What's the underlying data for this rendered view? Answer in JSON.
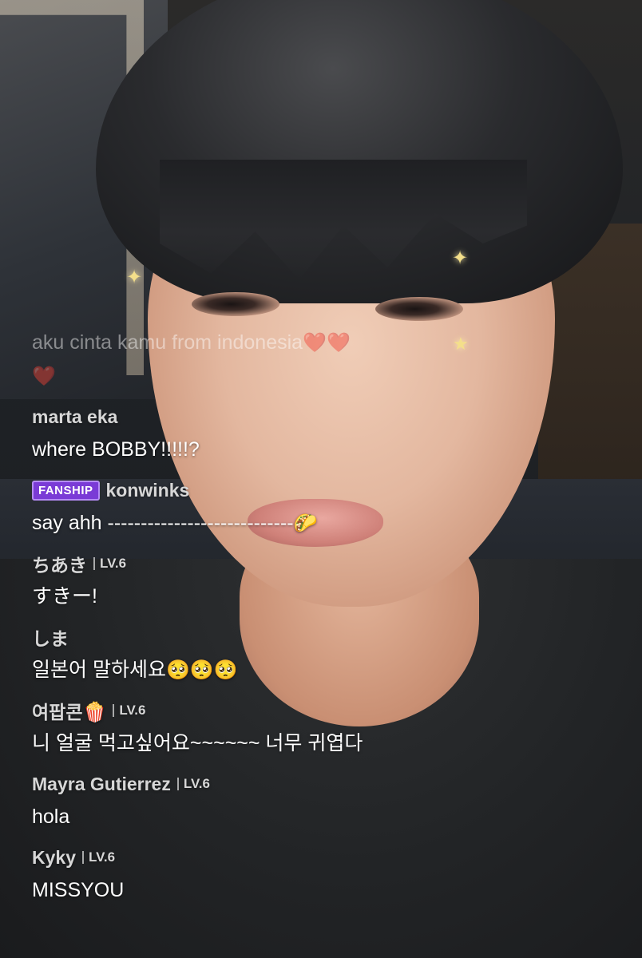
{
  "live_chat": {
    "messages": [
      {
        "text": "aku cinta kamu from indonesia",
        "emoji": "❤️❤️",
        "text_line2_emoji": "❤️",
        "faded": true
      },
      {
        "username": "marta eka",
        "text": "where BOBBY!!!!!?"
      },
      {
        "badge": "FANSHIP",
        "username": "konwinks",
        "text": "say ahh ----------------------------",
        "emoji": "🌮"
      },
      {
        "username": "ちあき",
        "level": "LV.6",
        "text": "すきー!"
      },
      {
        "username": "しま",
        "text": "일본어 말하세요",
        "emoji": "🥺🥺🥺"
      },
      {
        "username": "여팝콘",
        "username_emoji": "🍿",
        "level": "LV.6",
        "text": "니 얼굴 먹고싶어요~~~~~~ 너무 귀엽다"
      },
      {
        "username": "Mayra Gutierrez",
        "level": "LV.6",
        "text": "hola"
      },
      {
        "username": "Kyky",
        "level": "LV.6",
        "text": "MISSYOU"
      }
    ]
  },
  "overlay": {
    "sparkle_glyph": "✦",
    "star_glyph": "★"
  },
  "colors": {
    "username": "#d7d7d7",
    "message_text": "#ffffff",
    "fanship_badge": "#7a3bd6"
  }
}
